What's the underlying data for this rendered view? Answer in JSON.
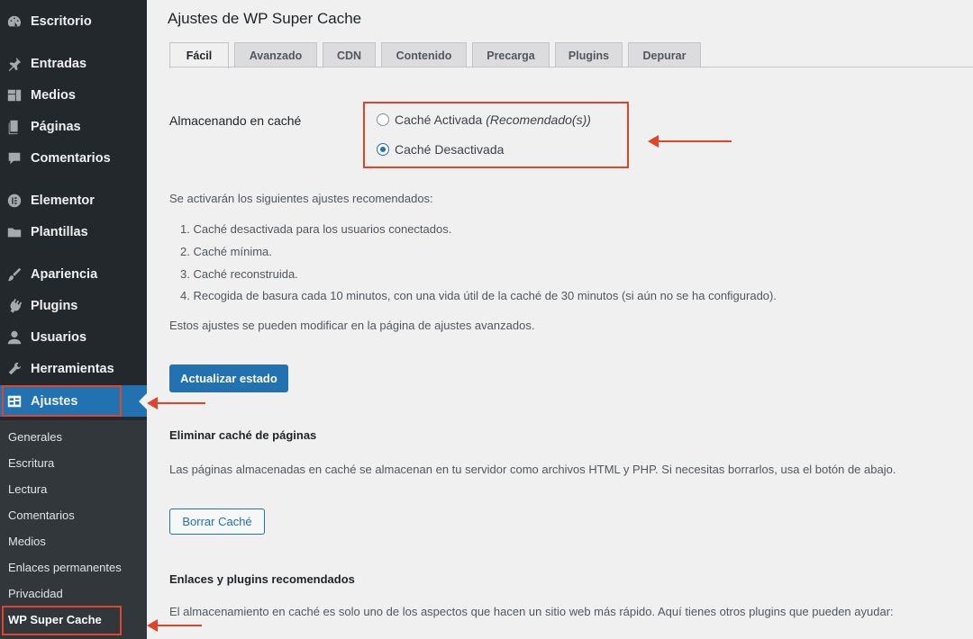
{
  "sidebar": {
    "items": [
      {
        "label": "Escritorio",
        "icon": "dashboard-icon"
      },
      {
        "label": "Entradas",
        "icon": "pushpin-icon"
      },
      {
        "label": "Medios",
        "icon": "media-icon"
      },
      {
        "label": "Páginas",
        "icon": "pages-icon"
      },
      {
        "label": "Comentarios",
        "icon": "comments-icon"
      },
      {
        "label": "Elementor",
        "icon": "elementor-icon"
      },
      {
        "label": "Plantillas",
        "icon": "folder-icon"
      },
      {
        "label": "Apariencia",
        "icon": "brush-icon"
      },
      {
        "label": "Plugins",
        "icon": "plugin-icon"
      },
      {
        "label": "Usuarios",
        "icon": "user-icon"
      },
      {
        "label": "Herramientas",
        "icon": "wrench-icon"
      },
      {
        "label": "Ajustes",
        "icon": "settings-icon"
      }
    ],
    "submenu": [
      "Generales",
      "Escritura",
      "Lectura",
      "Comentarios",
      "Medios",
      "Enlaces permanentes",
      "Privacidad",
      "WP Super Cache"
    ]
  },
  "page": {
    "title": "Ajustes de WP Super Cache",
    "tabs": [
      "Fácil",
      "Avanzado",
      "CDN",
      "Contenido",
      "Precarga",
      "Plugins",
      "Depurar"
    ],
    "caching_label": "Almacenando en caché",
    "radio_on": "Caché Activada",
    "radio_on_note": "(Recomendado(s))",
    "radio_off": "Caché Desactivada",
    "recommended_intro": "Se activarán los siguientes ajustes recomendados:",
    "recommended_list": [
      "1. Caché desactivada para los usuarios conectados.",
      "2. Caché mínima.",
      "3. Caché reconstruida.",
      "4. Recogida de basura cada 10 minutos, con una vida útil de la caché de 30 minutos (si aún no se ha configurado)."
    ],
    "advanced_note": "Estos ajustes se pueden modificar en la página de ajustes avanzados.",
    "update_button": "Actualizar estado",
    "delete_heading": "Eliminar caché de páginas",
    "delete_text": "Las páginas almacenadas en caché se almacenan en tu servidor como archivos HTML y PHP. Si necesitas borrarlos, usa el botón de abajo.",
    "delete_button": "Borrar Caché",
    "links_heading": "Enlaces y plugins recomendados",
    "links_text": "El almacenamiento en caché es solo uno de los aspectos que hacen un sitio web más rápido. Aquí tienes otros plugins que pueden ayudar:"
  },
  "colors": {
    "accent": "#2271b1",
    "annotation": "#e0442a",
    "sidebar": "#23282d"
  }
}
